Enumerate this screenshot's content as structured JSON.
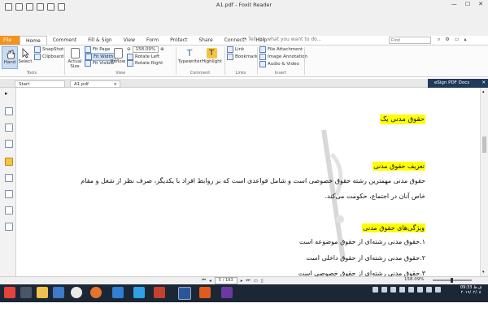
{
  "window": {
    "title": "A1.pdf - Foxit Reader"
  },
  "ribbon_tabs": [
    "File",
    "Home",
    "Comment",
    "Fill & Sign",
    "View",
    "Form",
    "Protect",
    "Share",
    "Connect",
    "Help"
  ],
  "tell_me": {
    "text": "Tell me what you want to do..."
  },
  "find": {
    "placeholder": "Find"
  },
  "tools": {
    "hand": "Hand",
    "select": "Select",
    "snapshot": "SnapShot",
    "clipboard": "Clipboard",
    "group": "Tools"
  },
  "view": {
    "actual_size": "Actual Size",
    "fit_page": "Fit Page",
    "fit_width": "Fit Width",
    "fit_visible": "Fit Visible",
    "reflow": "Reflow",
    "zoom": "158.09%",
    "rotate_left": "Rotate Left",
    "rotate_right": "Rotate Right",
    "group": "View"
  },
  "comment": {
    "typewriter": "Typewriter",
    "highlight": "Highlight",
    "group": "Comment"
  },
  "links": {
    "link": "Link",
    "bookmark": "Bookmark",
    "group": "Links"
  },
  "insert": {
    "file_attachment": "File Attachment",
    "image_annotation": "Image Annotation",
    "audio_video": "Audio & Video",
    "group": "Insert"
  },
  "doc_tabs": {
    "start": "Start",
    "current": "A1.pdf"
  },
  "esign": "eSign PDF Docs",
  "document": {
    "heading1": "حقوق مدنی یک",
    "heading2": "تعریف حقوق مدنی",
    "para_line1": "حقوق مدنی مهمترین رشته حقوق خصوصی است و شامل قواعدی است که بر روابط افراد با یکدیگر، صرف نظر از شغل و مقام",
    "para_line2": "خاص آنان در اجتماع، حکومت می‌کند.",
    "heading3": "ویژگی‌های حقوق مدنی",
    "item1": "۱.حقوق مدنی رشته‌ای از حقوق موضوعه است",
    "item2": "۲.حقوق مدنی رشته‌ای از حقوق داخلی است",
    "item3": "۳.حقوق مدنی رشته‌ای از حقوق خصوصی است"
  },
  "status": {
    "page": "5 / 193",
    "zoom": "158.09%"
  },
  "clock": {
    "time": "09:33 ق.ظ",
    "date": "۲۰۱۹/۰۲/۰۸"
  },
  "colors": {
    "file_tab": "#f39321",
    "highlight": "#ffff00",
    "taskbar": "#1c2735",
    "esign": "#1f3b5b"
  }
}
